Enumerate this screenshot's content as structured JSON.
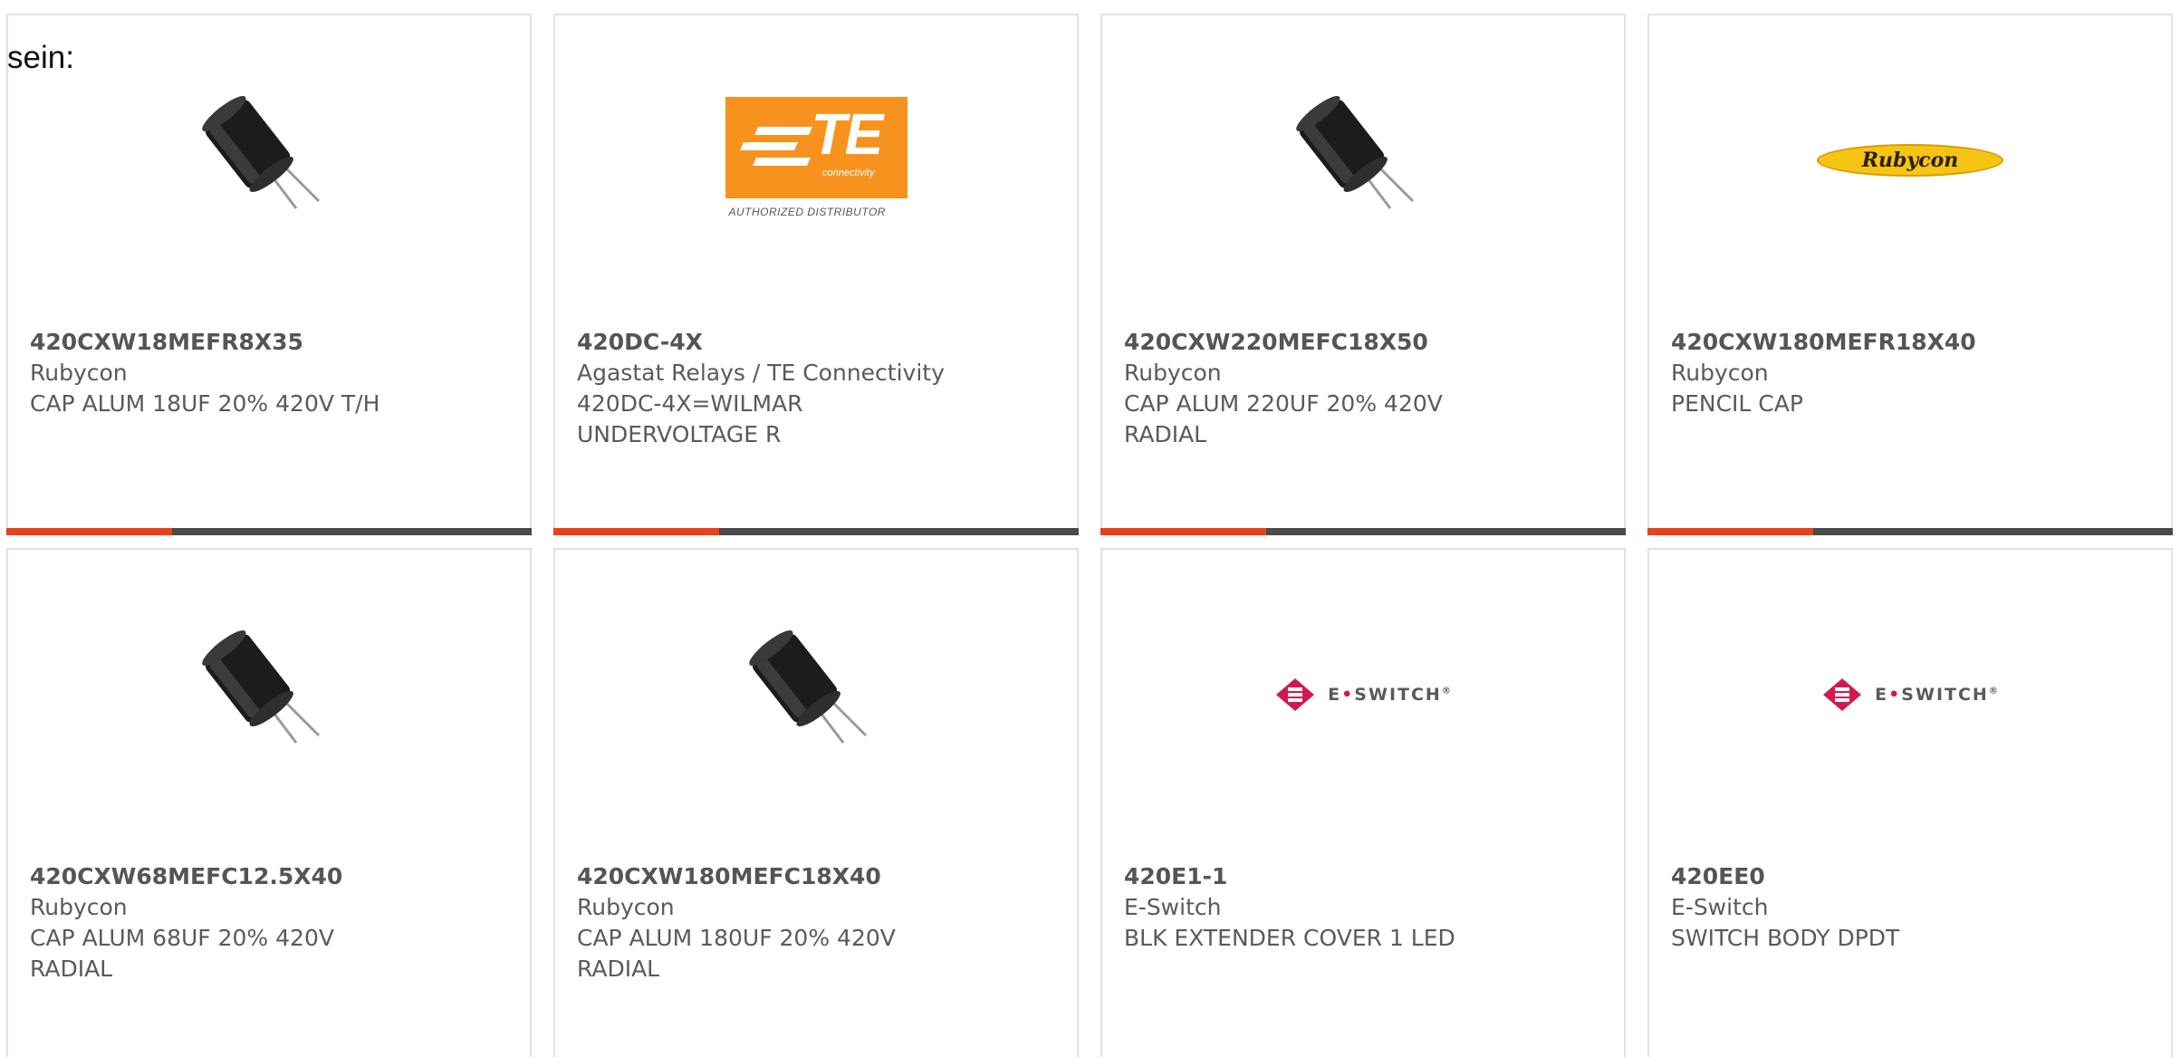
{
  "intro_text": "sein:",
  "colors": {
    "accent": "#e8421c",
    "bar": "#4a4a4a",
    "te_orange": "#f7921e",
    "rubycon_yellow": "#f6c413",
    "eswitch_red": "#d01a4f"
  },
  "logos": {
    "te": {
      "mark": "TE",
      "sub": "connectivity",
      "caption": "AUTHORIZED DISTRIBUTOR"
    },
    "rubycon": {
      "mark": "Rubycon"
    },
    "eswitch": {
      "left": "E",
      "dot": "•",
      "right": "SWITCH",
      "reg": "®"
    }
  },
  "cards": [
    {
      "part_number": "420CXW18MEFR8X35",
      "manufacturer": "Rubycon",
      "desc1": "CAP ALUM 18UF 20% 420V T/H",
      "desc2": "",
      "image": "capacitor-icon",
      "has_bar": true
    },
    {
      "part_number": "420DC-4X",
      "manufacturer": "Agastat Relays / TE Connectivity",
      "desc1": "420DC-4X=WILMAR",
      "desc2": "UNDERVOLTAGE R",
      "image": "te-logo",
      "has_bar": true
    },
    {
      "part_number": "420CXW220MEFC18X50",
      "manufacturer": "Rubycon",
      "desc1": "CAP ALUM 220UF 20% 420V",
      "desc2": "RADIAL",
      "image": "capacitor-icon",
      "has_bar": true
    },
    {
      "part_number": "420CXW180MEFR18X40",
      "manufacturer": "Rubycon",
      "desc1": "PENCIL CAP",
      "desc2": "",
      "image": "rubycon-logo",
      "has_bar": true
    },
    {
      "part_number": "420CXW68MEFC12.5X40",
      "manufacturer": "Rubycon",
      "desc1": "CAP ALUM 68UF 20% 420V",
      "desc2": "RADIAL",
      "image": "capacitor-icon",
      "has_bar": false
    },
    {
      "part_number": "420CXW180MEFC18X40",
      "manufacturer": "Rubycon",
      "desc1": "CAP ALUM 180UF 20% 420V",
      "desc2": "RADIAL",
      "image": "capacitor-icon",
      "has_bar": false
    },
    {
      "part_number": "420E1-1",
      "manufacturer": "E-Switch",
      "desc1": "BLK EXTENDER COVER 1 LED",
      "desc2": "",
      "image": "eswitch-logo",
      "has_bar": false
    },
    {
      "part_number": "420EE0",
      "manufacturer": "E-Switch",
      "desc1": "SWITCH BODY DPDT",
      "desc2": "",
      "image": "eswitch-logo",
      "has_bar": false
    }
  ]
}
